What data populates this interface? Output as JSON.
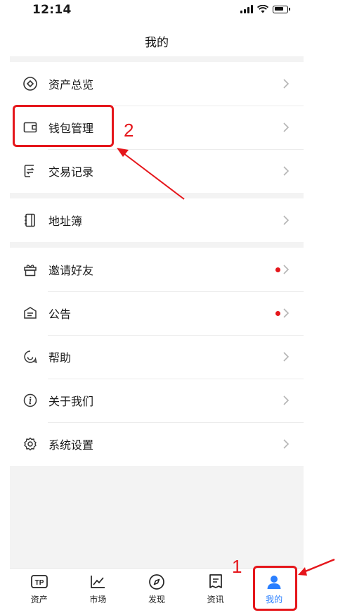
{
  "status_bar": {
    "time": "12:14"
  },
  "header": {
    "title": "我的"
  },
  "menu_groups": [
    {
      "items": [
        {
          "label": "资产总览",
          "icon": "asset-overview-icon"
        },
        {
          "label": "钱包管理",
          "icon": "wallet-icon"
        },
        {
          "label": "交易记录",
          "icon": "transaction-record-icon"
        }
      ]
    },
    {
      "items": [
        {
          "label": "地址簿",
          "icon": "address-book-icon"
        }
      ]
    },
    {
      "items": [
        {
          "label": "邀请好友",
          "icon": "gift-icon",
          "badge": "red-dot"
        },
        {
          "label": "公告",
          "icon": "announcement-icon",
          "badge": "red-dot"
        },
        {
          "label": "帮助",
          "icon": "help-icon"
        },
        {
          "label": "关于我们",
          "icon": "info-icon"
        },
        {
          "label": "系统设置",
          "icon": "settings-icon"
        }
      ]
    }
  ],
  "tabbar": {
    "tabs": [
      {
        "label": "资产",
        "icon": "tp-wallet-icon"
      },
      {
        "label": "市场",
        "icon": "market-chart-icon"
      },
      {
        "label": "发现",
        "icon": "compass-icon"
      },
      {
        "label": "资讯",
        "icon": "news-icon"
      },
      {
        "label": "我的",
        "icon": "person-icon",
        "active": true
      }
    ]
  },
  "annotations": [
    {
      "number": "1",
      "target": "我的"
    },
    {
      "number": "2",
      "target": "钱包管理"
    }
  ],
  "colors": {
    "annotation": "#e5161b",
    "active_tab": "#2a7fff",
    "badge": "#e5161b",
    "page_background": "#f3f3f3"
  }
}
